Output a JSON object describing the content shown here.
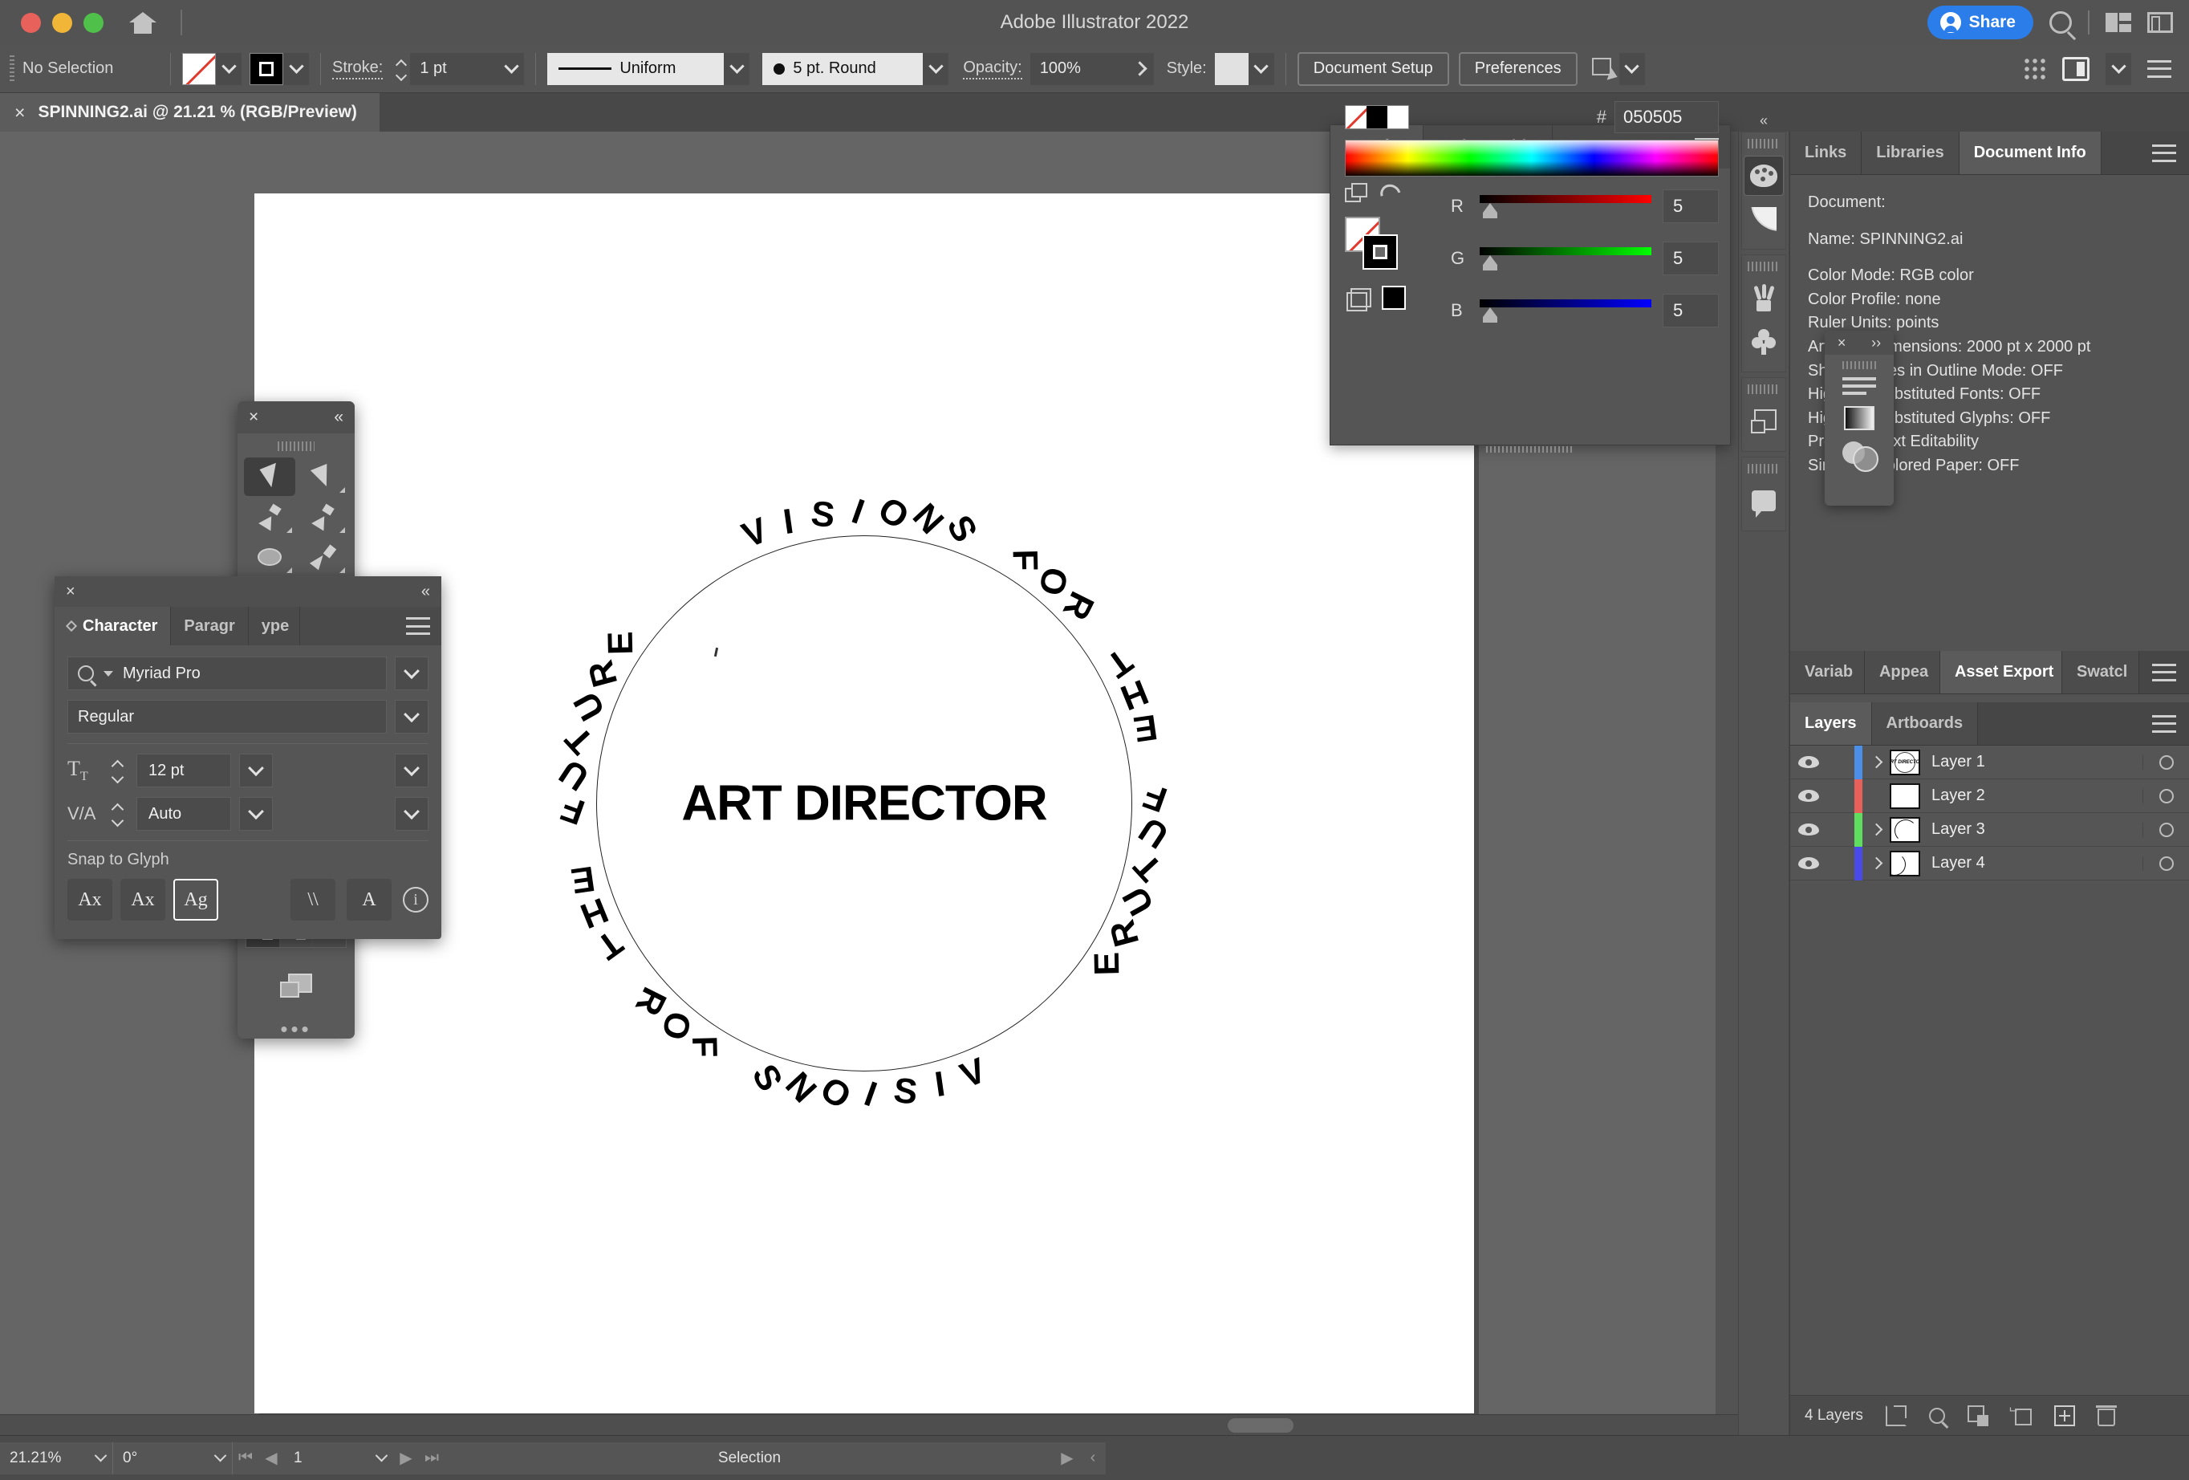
{
  "window": {
    "app_title": "Adobe Illustrator 2022",
    "traffic_lights": [
      "close",
      "minimize",
      "maximize"
    ],
    "home_icon": "home-icon",
    "share_label": "Share",
    "search_icon": "search-icon",
    "arrange_icon": "arrange-documents-icon",
    "workspace_icon": "workspace-switcher-icon"
  },
  "control_bar": {
    "selection_status": "No Selection",
    "fill_swatch": "none-swatch",
    "stroke_swatch": "black-stroke-swatch",
    "stroke_label": "Stroke:",
    "stroke_weight": "1 pt",
    "stroke_profile": "Uniform",
    "brush_definition": "5 pt. Round",
    "opacity_label": "Opacity:",
    "opacity_value": "100%",
    "style_label": "Style:",
    "document_setup": "Document Setup",
    "preferences": "Preferences",
    "align_icon": "align-to-selection-icon",
    "grid_icon": "grid-dots-icon",
    "doc_mode_icon": "document-arrange-icon",
    "menu_icon": "panel-menu-icon"
  },
  "document_tab": {
    "close_glyph": "×",
    "title": "SPINNING2.ai @ 21.21 % (RGB/Preview)"
  },
  "artwork": {
    "center_text": "ART DIRECTOR",
    "ring_text": "VISIONS FOR THE FUTURE    VISIONS FOR THE FUTURE    "
  },
  "color_panel": {
    "tabs": [
      {
        "label": "Color",
        "active": true
      },
      {
        "label": "Color Guide",
        "active": false
      }
    ],
    "collapse_glyph": "»",
    "menu_icon": "panel-menu-icon",
    "channels": [
      {
        "label": "R",
        "value": "5"
      },
      {
        "label": "G",
        "value": "5"
      },
      {
        "label": "B",
        "value": "5"
      }
    ],
    "hex_label": "#",
    "hex_value": "050505",
    "swatches": [
      "none",
      "black",
      "white"
    ]
  },
  "mini_panel": {
    "close_glyph": "×",
    "expand_glyph": "››",
    "items": [
      "align-lines-icon",
      "gradient-icon",
      "transparency-icon"
    ]
  },
  "tool_palette": {
    "close_glyph": "×",
    "collapse_glyph": "«",
    "tools": [
      {
        "name": "selection-tool",
        "selected": true
      },
      {
        "name": "direct-selection-tool",
        "selected": false
      },
      {
        "name": "pen-tool",
        "selected": false
      },
      {
        "name": "curvature-tool",
        "selected": false
      },
      {
        "name": "ellipse-tool",
        "selected": false
      },
      {
        "name": "paintbrush-tool",
        "selected": false
      },
      {
        "name": "type-tool",
        "selected": false
      },
      {
        "name": "free-transform-tool",
        "selected": false
      },
      {
        "name": "eraser-tool",
        "selected": false
      },
      {
        "name": "shaper-tool",
        "selected": false
      },
      {
        "name": "gradient-tool",
        "selected": false
      },
      {
        "name": "eyedropper-tool",
        "selected": false
      },
      {
        "name": "blend-tool",
        "selected": false
      },
      {
        "name": "shape-builder-tool",
        "selected": false
      },
      {
        "name": "artboard-tool",
        "selected": false
      },
      {
        "name": "zoom-tool",
        "selected": false
      }
    ],
    "fill_stroke": {
      "fill": "none",
      "stroke": "black"
    },
    "color_modes": [
      "color-mode",
      "gradient-mode",
      "none-mode"
    ],
    "draw_modes": [
      "draw-normal",
      "draw-behind",
      "draw-inside"
    ],
    "screen_mode": "screen-mode-icon",
    "more_glyph": "•••"
  },
  "character_panel": {
    "close_glyph": "×",
    "collapse_glyph": "«",
    "tabs": [
      {
        "label": "Character",
        "active": true
      },
      {
        "label": "Paragr",
        "active": false
      },
      {
        "label": "ype",
        "active": false
      }
    ],
    "font_family": "Myriad Pro",
    "font_style": "Regular",
    "font_size": "12 pt",
    "leading": "Auto",
    "snap_label": "Snap to Glyph",
    "glyph_buttons": [
      "Ax",
      "Ax",
      "Ag"
    ],
    "extra_buttons": [
      "italic-slant-icon",
      "superscript-icon"
    ],
    "info_icon": "info-icon"
  },
  "right_dock": {
    "rail_collapse": "«",
    "rail_icons": [
      "swatches-palette-icon",
      "color-guide-fan-icon",
      "brushes-icon",
      "symbols-icon",
      "layers-square-icon",
      "comments-icon"
    ],
    "top_tabs": [
      {
        "label": "Links",
        "active": false
      },
      {
        "label": "Libraries",
        "active": false
      },
      {
        "label": "Document Info",
        "active": true
      }
    ],
    "doc_info": {
      "heading": "Document:",
      "name_line": "Name: SPINNING2.ai",
      "lines": [
        "Color Mode: RGB color",
        "Color Profile: none",
        "Ruler Units: points",
        "Artboard Dimensions: 2000 pt x 2000 pt",
        "Show Images in Outline Mode: OFF",
        "Highlight Substituted Fonts: OFF",
        "Highlight Substituted Glyphs: OFF",
        "Preserve Text Editability",
        "Simulate Colored Paper: OFF"
      ]
    },
    "mid_tabs": [
      {
        "label": "Variab",
        "active": false
      },
      {
        "label": "Appea",
        "active": false
      },
      {
        "label": "Asset Export",
        "active": true
      },
      {
        "label": "Swatcl",
        "active": false
      }
    ],
    "layers_tabs": [
      {
        "label": "Layers",
        "active": true
      },
      {
        "label": "Artboards",
        "active": false
      }
    ],
    "layers": [
      {
        "name": "Layer 1",
        "color": "#4b8fe8",
        "visible": true,
        "has_children": true,
        "thumb": "art-circle-text"
      },
      {
        "name": "Layer 2",
        "color": "#e8605a",
        "visible": true,
        "has_children": false,
        "thumb": "blank"
      },
      {
        "name": "Layer 3",
        "color": "#5ede5e",
        "visible": true,
        "has_children": true,
        "thumb": "arc-left"
      },
      {
        "name": "Layer 4",
        "color": "#4a4ae8",
        "visible": true,
        "has_children": true,
        "thumb": "arc-right"
      }
    ],
    "layers_footer": {
      "count_label": "4 Layers",
      "icons": [
        "export-icon",
        "search-icon",
        "create-sublayer-icon",
        "new-sublayer-icon",
        "new-layer-icon",
        "delete-layer-icon"
      ]
    }
  },
  "status_bar": {
    "zoom_value": "21.21%",
    "rotation_value": "0°",
    "artboard_number": "1",
    "status_text": "Selection",
    "nav_first": "⏮",
    "nav_prev": "◀",
    "nav_next": "▶",
    "nav_last": "⏭",
    "play_glyph": "▶",
    "back_glyph": "‹"
  }
}
